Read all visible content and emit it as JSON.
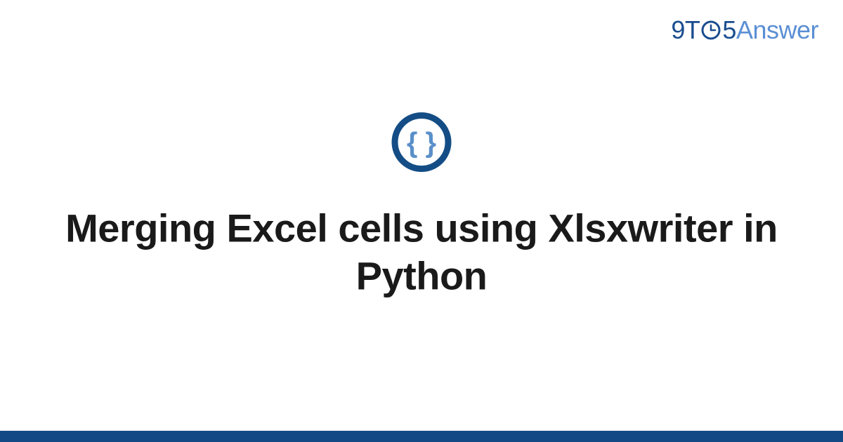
{
  "logo": {
    "part1": "9T",
    "part2": "5",
    "part3": "Answer"
  },
  "badge": {
    "name": "curly-braces-icon"
  },
  "title": "Merging Excel cells using Xlsxwriter in Python",
  "colors": {
    "brand_dark": "#1a4d8f",
    "brand_light": "#5b8fd4",
    "footer": "#134a86",
    "icon_ring": "#144d85",
    "icon_glyph": "#5a8fc9"
  }
}
